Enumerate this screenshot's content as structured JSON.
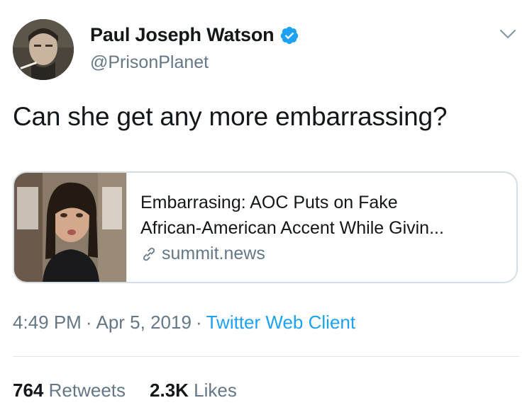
{
  "author": {
    "name": "Paul Joseph Watson",
    "handle": "@PrisonPlanet",
    "verified": true,
    "avatar_icon": "user-avatar"
  },
  "tweet": {
    "text": "Can she get any more embarrassing?"
  },
  "link_card": {
    "title_line1": "Embarrasing: AOC Puts on Fake",
    "title_line2": "African-American Accent While Givin...",
    "domain": "summit.news",
    "link_icon": "link-icon"
  },
  "meta": {
    "time": "4:49 PM",
    "separator": "·",
    "date": "Apr 5, 2019",
    "client": "Twitter Web Client"
  },
  "stats": {
    "retweets_count": "764",
    "retweets_label": "Retweets",
    "likes_count": "2.3K",
    "likes_label": "Likes"
  },
  "colors": {
    "accent": "#1da1f2",
    "secondary_text": "#657786",
    "primary_text": "#14171a"
  }
}
